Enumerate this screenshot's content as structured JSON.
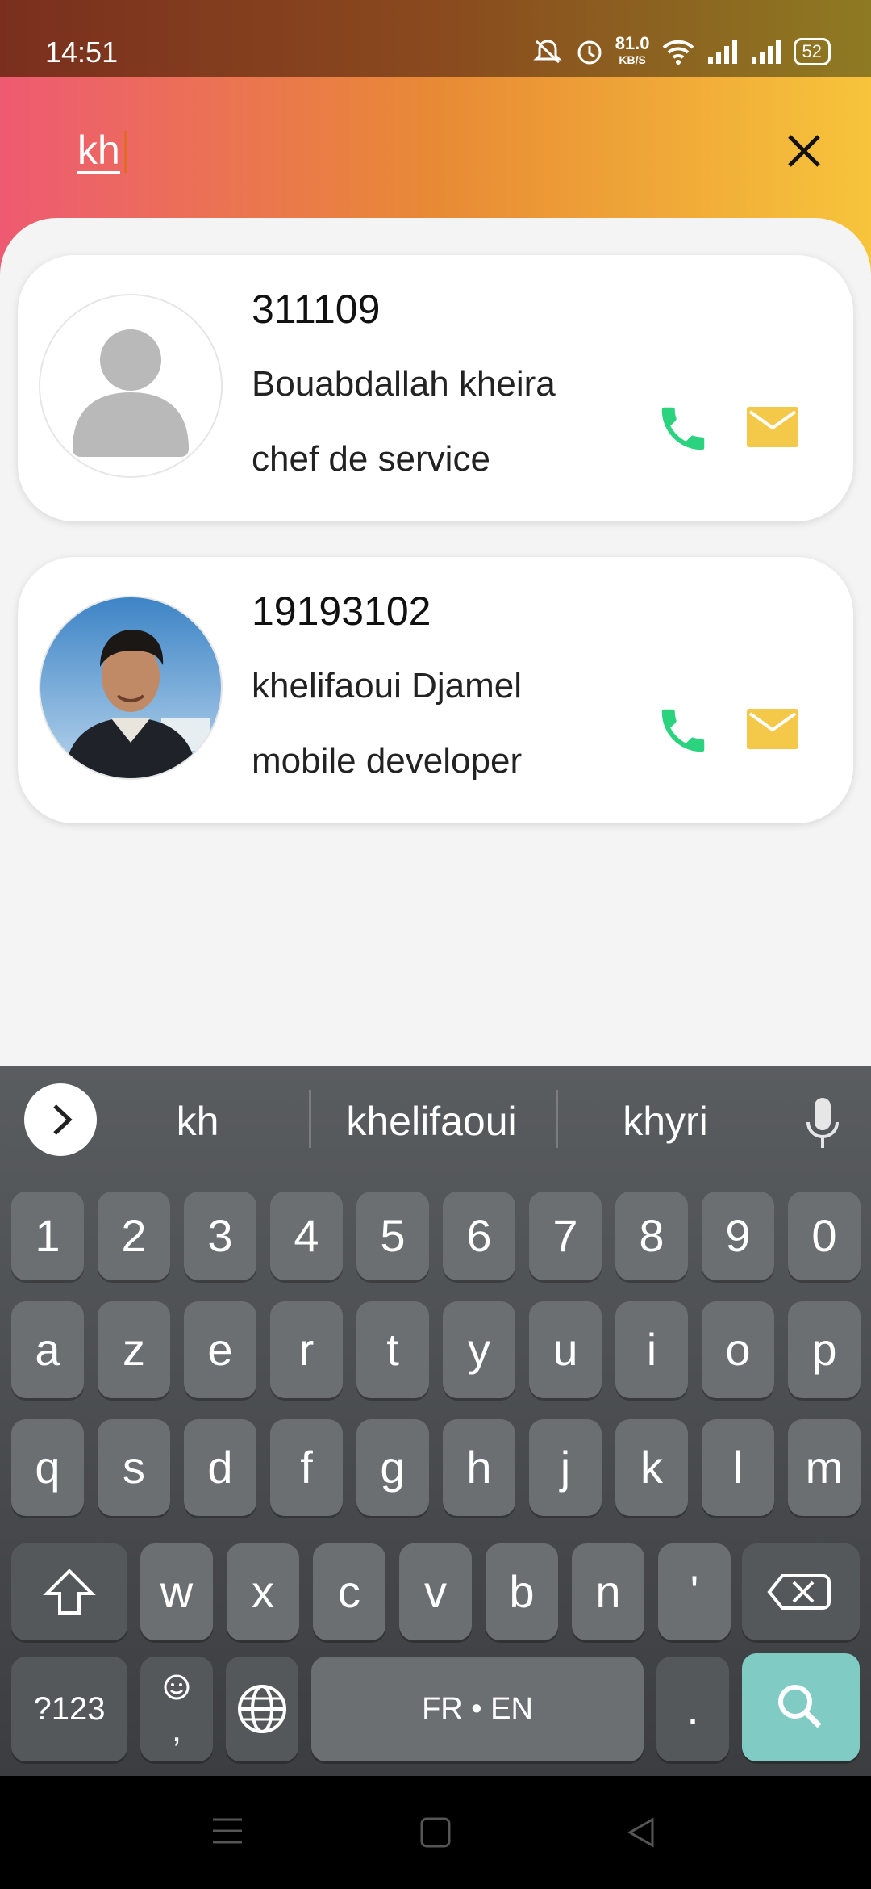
{
  "status": {
    "time": "14:51",
    "net_speed_value": "81.0",
    "net_speed_unit": "KB/S",
    "battery": "52"
  },
  "search": {
    "query": "kh"
  },
  "contacts": [
    {
      "id": "311109",
      "name": "Bouabdallah  kheira",
      "role": "chef de service",
      "avatar": "default-person-icon"
    },
    {
      "id": "19193102",
      "name": "khelifaoui  Djamel",
      "role": "mobile developer",
      "avatar": "profile-photo"
    }
  ],
  "colors": {
    "phone": "#2bd37e",
    "mail": "#f4c94a",
    "search_key": "#80cbc4"
  },
  "keyboard": {
    "suggestions": [
      "kh",
      "khelifaoui",
      "khyri"
    ],
    "row_numbers": [
      "1",
      "2",
      "3",
      "4",
      "5",
      "6",
      "7",
      "8",
      "9",
      "0"
    ],
    "row1": [
      "a",
      "z",
      "e",
      "r",
      "t",
      "y",
      "u",
      "i",
      "o",
      "p"
    ],
    "row2": [
      "q",
      "s",
      "d",
      "f",
      "g",
      "h",
      "j",
      "k",
      "l",
      "m"
    ],
    "row3": [
      "w",
      "x",
      "c",
      "v",
      "b",
      "n",
      "'"
    ],
    "symbols_key": "?123",
    "comma_key": ",",
    "space_label": "FR • EN",
    "period_key": "."
  }
}
